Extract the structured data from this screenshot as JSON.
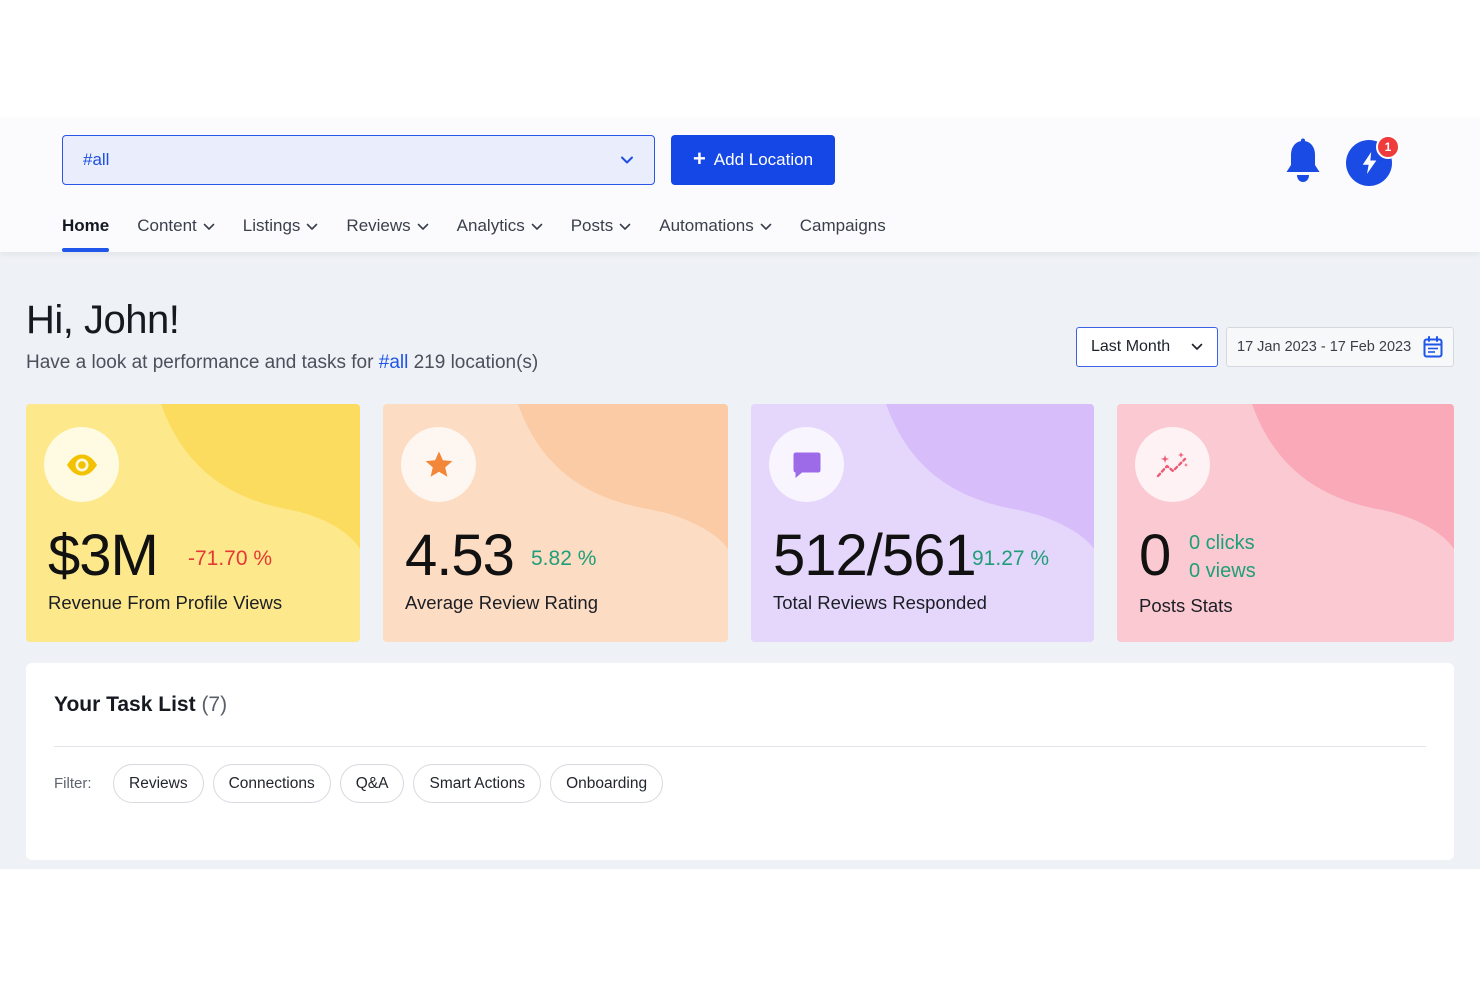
{
  "header": {
    "location_select": {
      "value": "#all"
    },
    "add_location_label": "Add Location",
    "notifications_badge": "1"
  },
  "nav": {
    "items": [
      {
        "label": "Home",
        "active": true,
        "dropdown": false
      },
      {
        "label": "Content",
        "active": false,
        "dropdown": true
      },
      {
        "label": "Listings",
        "active": false,
        "dropdown": true
      },
      {
        "label": "Reviews",
        "active": false,
        "dropdown": true
      },
      {
        "label": "Analytics",
        "active": false,
        "dropdown": true
      },
      {
        "label": "Posts",
        "active": false,
        "dropdown": true
      },
      {
        "label": "Automations",
        "active": false,
        "dropdown": true
      },
      {
        "label": "Campaigns",
        "active": false,
        "dropdown": false
      }
    ]
  },
  "greeting": {
    "title": "Hi, John!",
    "subtitle_prefix": "Have a look at performance and tasks for",
    "subtitle_tag": "#all",
    "subtitle_suffix": "219 location(s)"
  },
  "date_filter": {
    "range_label": "Last Month",
    "date_range": "17 Jan 2023 - 17 Feb 2023"
  },
  "stats": [
    {
      "value": "$3M",
      "change": "-71.70 %",
      "label": "Revenue From Profile Views",
      "icon": "eye-icon",
      "trend": "negative"
    },
    {
      "value": "4.53",
      "change": "5.82 %",
      "label": "Average Review Rating",
      "icon": "star-icon",
      "trend": "positive"
    },
    {
      "value": "512/561",
      "change": "91.27 %",
      "label": "Total Reviews Responded",
      "icon": "chat-bubble-icon",
      "trend": "positive"
    },
    {
      "value": "0",
      "clicks": "0 clicks",
      "views": "0 views",
      "label": "Posts Stats",
      "icon": "sparkle-trend-icon"
    }
  ],
  "tasks": {
    "title": "Your Task List",
    "count": "(7)",
    "filter_label": "Filter:",
    "filters": [
      "Reviews",
      "Connections",
      "Q&A",
      "Smart Actions",
      "Onboarding"
    ]
  },
  "colors": {
    "primary": "#1447e6",
    "negative": "#e53935",
    "positive": "#1f9e7a",
    "card_yellow": "#fde98b",
    "card_peach": "#fcdcc2",
    "card_lavender": "#e5d7fb",
    "card_pink": "#fbc9d2"
  }
}
